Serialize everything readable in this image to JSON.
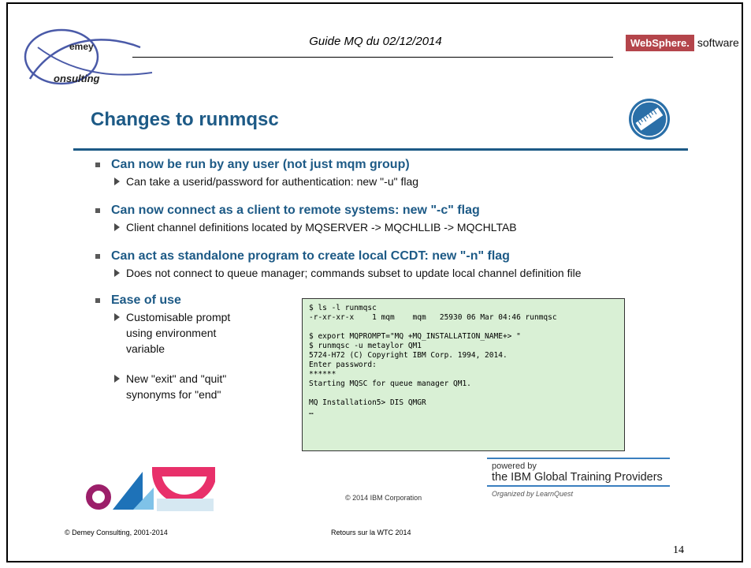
{
  "header": {
    "title": "Guide MQ du 02/12/2014",
    "logo_line1": "emey",
    "logo_line2": "onsulting",
    "badge_box": "WebSphere.",
    "badge_text": "software"
  },
  "slide": {
    "title": "Changes to runmqsc",
    "bullets": [
      {
        "main": "Can now be run by any user (not just mqm group)",
        "sub": "Can take a userid/password for authentication: new \"-u\" flag"
      },
      {
        "main": "Can now connect as a client to remote systems: new \"-c\" flag",
        "sub": "Client channel definitions located by MQSERVER -> MQCHLLIB -> MQCHLTAB"
      },
      {
        "main": "Can act as standalone program to create local CCDT: new \"-n\" flag",
        "sub": "Does not connect to queue manager; commands subset to update local channel definition file"
      },
      {
        "main": "Ease of use",
        "sub_items": [
          [
            "Customisable prompt",
            "using environment",
            "variable"
          ],
          [
            "New \"exit\" and \"quit\"",
            "synonyms for \"end\""
          ]
        ]
      }
    ],
    "code_lines": [
      "$ ls -l runmqsc",
      "-r-xr-xr-x    1 mqm    mqm   25930 06 Mar 04:46 runmqsc",
      "",
      "$ export MQPROMPT=\"MQ +MQ_INSTALLATION_NAME+> \"",
      "$ runmqsc -u metaylor QM1",
      "5724-H72 (C) Copyright IBM Corp. 1994, 2014.",
      "Enter password:",
      "******",
      "Starting MQSC for queue manager QM1.",
      "",
      "MQ Installation5> DIS QMGR",
      "…"
    ],
    "ibm_copyright": "© 2014 IBM Corporation",
    "powered": {
      "line1": "powered by",
      "line2": "the IBM Global Training Providers",
      "line3": "Organized by LearnQuest"
    }
  },
  "footer": {
    "left": "© Demey Consulting, 2001-2014",
    "center": "Retours sur la WTC 2014",
    "page_number": "14"
  },
  "colors": {
    "accent": "#1d5a86",
    "badge": "#b4454b",
    "code_bg": "#d9f0d5"
  }
}
